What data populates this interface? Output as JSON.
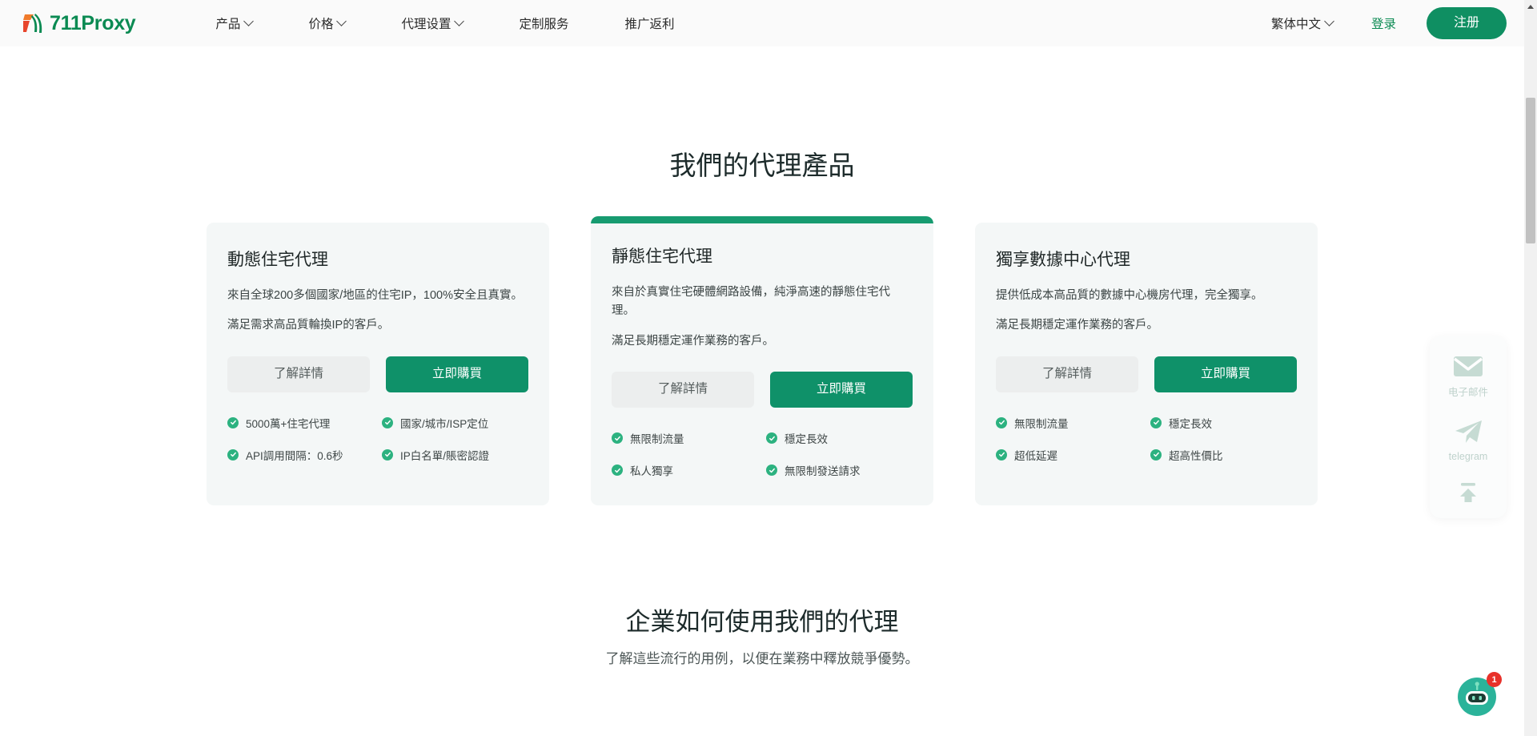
{
  "header": {
    "logo_text": "711Proxy",
    "nav": [
      {
        "label": "产品",
        "has_caret": true
      },
      {
        "label": "价格",
        "has_caret": true
      },
      {
        "label": "代理设置",
        "has_caret": true
      },
      {
        "label": "定制服务",
        "has_caret": false
      },
      {
        "label": "推广返利",
        "has_caret": false
      }
    ],
    "language": "繁体中文",
    "login_label": "登录",
    "signup_label": "注册"
  },
  "main": {
    "section_title": "我們的代理產品",
    "cards": [
      {
        "title": "動態住宅代理",
        "desc1": "來自全球200多個國家/地區的住宅IP，100%安全且真實。",
        "desc2": "滿足需求高品質輪換IP的客戶。",
        "btn_secondary": "了解詳情",
        "btn_primary": "立即購買",
        "features": [
          "5000萬+住宅代理",
          "國家/城市/ISP定位",
          "API調用間隔：0.6秒",
          "IP白名單/賬密認證"
        ],
        "featured": false
      },
      {
        "title": "靜態住宅代理",
        "desc1": "來自於真實住宅硬體網路設備，純淨高速的靜態住宅代理。",
        "desc2": "滿足長期穩定運作業務的客戶。",
        "btn_secondary": "了解詳情",
        "btn_primary": "立即購買",
        "features": [
          "無限制流量",
          "穩定長效",
          "私人獨享",
          "無限制發送請求"
        ],
        "featured": true
      },
      {
        "title": "獨享數據中心代理",
        "desc1": "提供低成本高品質的數據中心機房代理，完全獨享。",
        "desc2": "滿足長期穩定運作業務的客戶。",
        "btn_secondary": "了解詳情",
        "btn_primary": "立即購買",
        "features": [
          "無限制流量",
          "穩定長效",
          "超低延遲",
          "超高性價比"
        ],
        "featured": false
      }
    ],
    "bottom_title": "企業如何使用我們的代理",
    "bottom_subtitle": "了解這些流行的用例，以便在業務中釋放競爭優勢。"
  },
  "side_widget": {
    "email_label": "电子邮件",
    "telegram_label": "telegram"
  },
  "chat": {
    "badge_count": "1"
  },
  "colors": {
    "accent_green": "#0f8f62",
    "featured_bar": "#179b70",
    "check_green": "#2cb280",
    "card_bg": "#f4f7f7",
    "badge_red": "#e8312a"
  }
}
